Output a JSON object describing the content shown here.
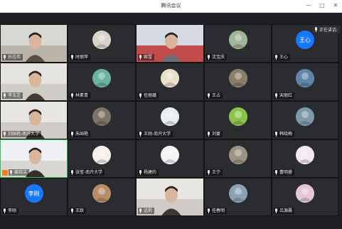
{
  "window": {
    "title": "腾讯会议"
  },
  "window_buttons": {
    "minimize": "—",
    "maximize": "□",
    "close": "✕"
  },
  "speaking": {
    "label": "正在讲话:"
  },
  "participants": [
    {
      "name": "孙志伟",
      "type": "video"
    },
    {
      "name": "时丽萍",
      "type": "avatar",
      "icon": "cat-icon",
      "color": "#d9d3c9"
    },
    {
      "name": "姬雪",
      "type": "video"
    },
    {
      "name": "沈宝庆",
      "type": "avatar",
      "icon": "building-icon",
      "color": "#9fb59a"
    },
    {
      "name": "王心",
      "type": "text-avatar",
      "initials": "王心",
      "color": "#1677ff"
    },
    {
      "name": "李玉芝",
      "type": "video"
    },
    {
      "name": "林素青",
      "type": "avatar",
      "icon": "flower-icon",
      "color": "#6bb3a1"
    },
    {
      "name": "任丽璐",
      "type": "avatar",
      "icon": "cartoon-icon",
      "color": "#e8e0c8"
    },
    {
      "name": "王占",
      "type": "avatar",
      "icon": "photo-icon",
      "color": "#8a7f6a"
    },
    {
      "name": "宋丽红",
      "type": "avatar",
      "icon": "landscape-icon",
      "color": "#5f86a8"
    },
    {
      "name": "刘国艳-南开大学",
      "type": "video"
    },
    {
      "name": "朱国艳",
      "type": "avatar",
      "icon": "photo-icon",
      "color": "#7d7366"
    },
    {
      "name": "王刚-南开大学",
      "type": "avatar",
      "icon": "emblem-icon",
      "color": "#e9eef5"
    },
    {
      "name": "刘宴",
      "type": "avatar",
      "icon": "emoji-icon",
      "color": "#8cc34f"
    },
    {
      "name": "韩晓梅",
      "type": "avatar",
      "icon": "landscape-icon",
      "color": "#7d9aab"
    },
    {
      "name": "姜晓洁",
      "type": "video",
      "active": true
    },
    {
      "name": "张莹-南开大学",
      "type": "avatar",
      "icon": "logo-icon",
      "color": "#f4efe9"
    },
    {
      "name": "杨建的",
      "type": "avatar",
      "icon": "portrait-icon",
      "color": "#f3f3f3"
    },
    {
      "name": "王宁",
      "type": "avatar",
      "icon": "photo-icon",
      "color": "#9e9484"
    },
    {
      "name": "蕾明睿",
      "type": "avatar",
      "icon": "cartoon-icon",
      "color": "#f1e9ef"
    },
    {
      "name": "李刚",
      "type": "text-avatar",
      "initials": "李刚",
      "color": "#1677ff"
    },
    {
      "name": "王跃",
      "type": "avatar",
      "icon": "pattern-icon",
      "color": "#b78e6c"
    },
    {
      "name": "话莉",
      "type": "video"
    },
    {
      "name": "任春明",
      "type": "avatar",
      "icon": "landscape-icon",
      "color": "#8aa3b6"
    },
    {
      "name": "吕源晨",
      "type": "avatar",
      "icon": "heart-icon",
      "color": "#e5c6d6"
    }
  ],
  "colors": {
    "active_border": "#2fbf5a",
    "share_badge": "#ff7a1a",
    "text_avatar": "#1677ff"
  }
}
